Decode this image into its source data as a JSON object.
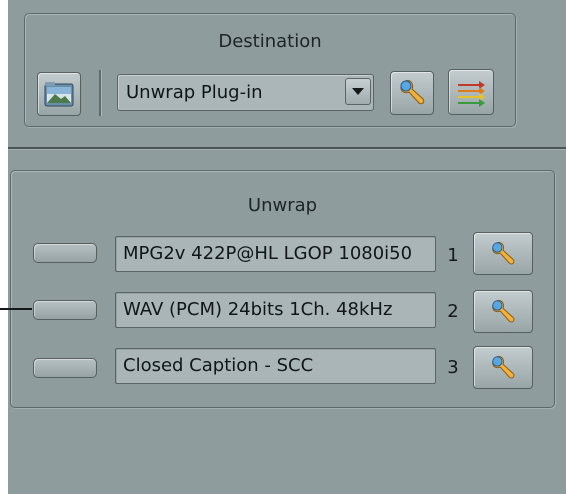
{
  "destination": {
    "title": "Destination",
    "plugin_select": {
      "value": "Unwrap Plug-in"
    }
  },
  "unwrap": {
    "title": "Unwrap",
    "tracks": [
      {
        "label": "MPG2v 422P@HL LGOP 1080i50",
        "index": "1"
      },
      {
        "label": "WAV (PCM) 24bits 1Ch. 48kHz",
        "index": "2"
      },
      {
        "label": "Closed Caption - SCC",
        "index": "3"
      }
    ]
  },
  "icons": {
    "browse": "folder-image-icon",
    "settings": "wrench-icon",
    "routing": "routing-arrows-icon",
    "dropdown": "chevron-down-icon"
  }
}
